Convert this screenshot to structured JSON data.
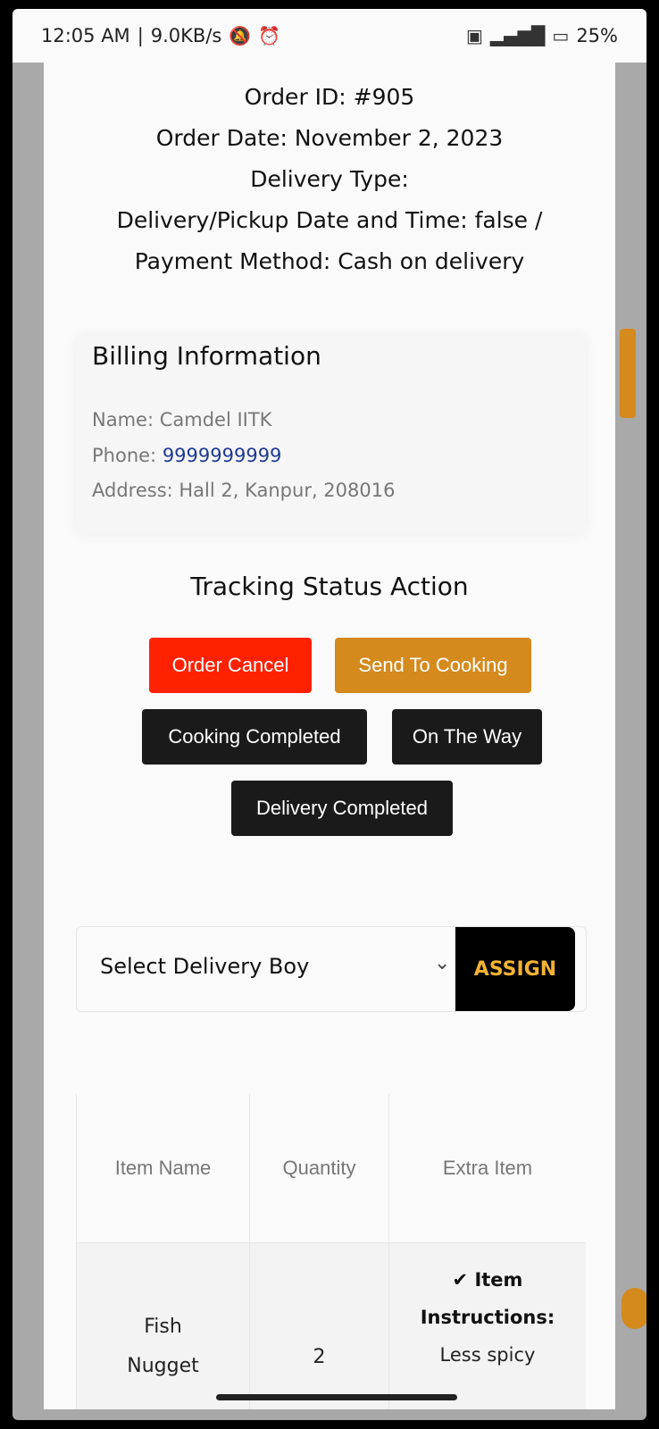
{
  "status_bar": {
    "time": "12:05 AM",
    "speed": "9.0KB/s",
    "battery": "25%",
    "icons": [
      "mute-icon",
      "alarm-icon",
      "sim-icon",
      "signal-icon",
      "battery-icon"
    ]
  },
  "order": {
    "id_line": "Order ID: #905",
    "date_line": "Order Date: November 2, 2023",
    "delivery_type_line": "Delivery Type:",
    "datetime_line": "Delivery/Pickup Date and Time: false /",
    "payment_line": "Payment Method: Cash on delivery"
  },
  "billing": {
    "title": "Billing Information",
    "name": "Name: Camdel IITK",
    "phone_label": "Phone: ",
    "phone_value": "9999999999",
    "address": "Address: Hall 2, Kanpur, 208016"
  },
  "tracking": {
    "title": "Tracking Status Action",
    "buttons": {
      "cancel": "Order Cancel",
      "send_cooking": "Send To Cooking",
      "cooking_completed": "Cooking Completed",
      "on_the_way": "On The Way",
      "delivery_completed": "Delivery Completed"
    }
  },
  "assign": {
    "select_value": "Select Delivery Boy",
    "button": "ASSIGN"
  },
  "table": {
    "headers": [
      "Item Name",
      "Quantity",
      "Extra Item"
    ],
    "rows": [
      {
        "item_line1": "Fish",
        "item_line2": "Nugget",
        "quantity": "2",
        "extra_line1": "✔ Item",
        "extra_line2": "Instructions:",
        "extra_line3": "Less spicy"
      }
    ]
  },
  "colors": {
    "cancel": "#ff2200",
    "cooking": "#d48a1d",
    "dark": "#1a1a1a",
    "assign_text": "#f2b233",
    "phone_link": "#1f3a93"
  }
}
